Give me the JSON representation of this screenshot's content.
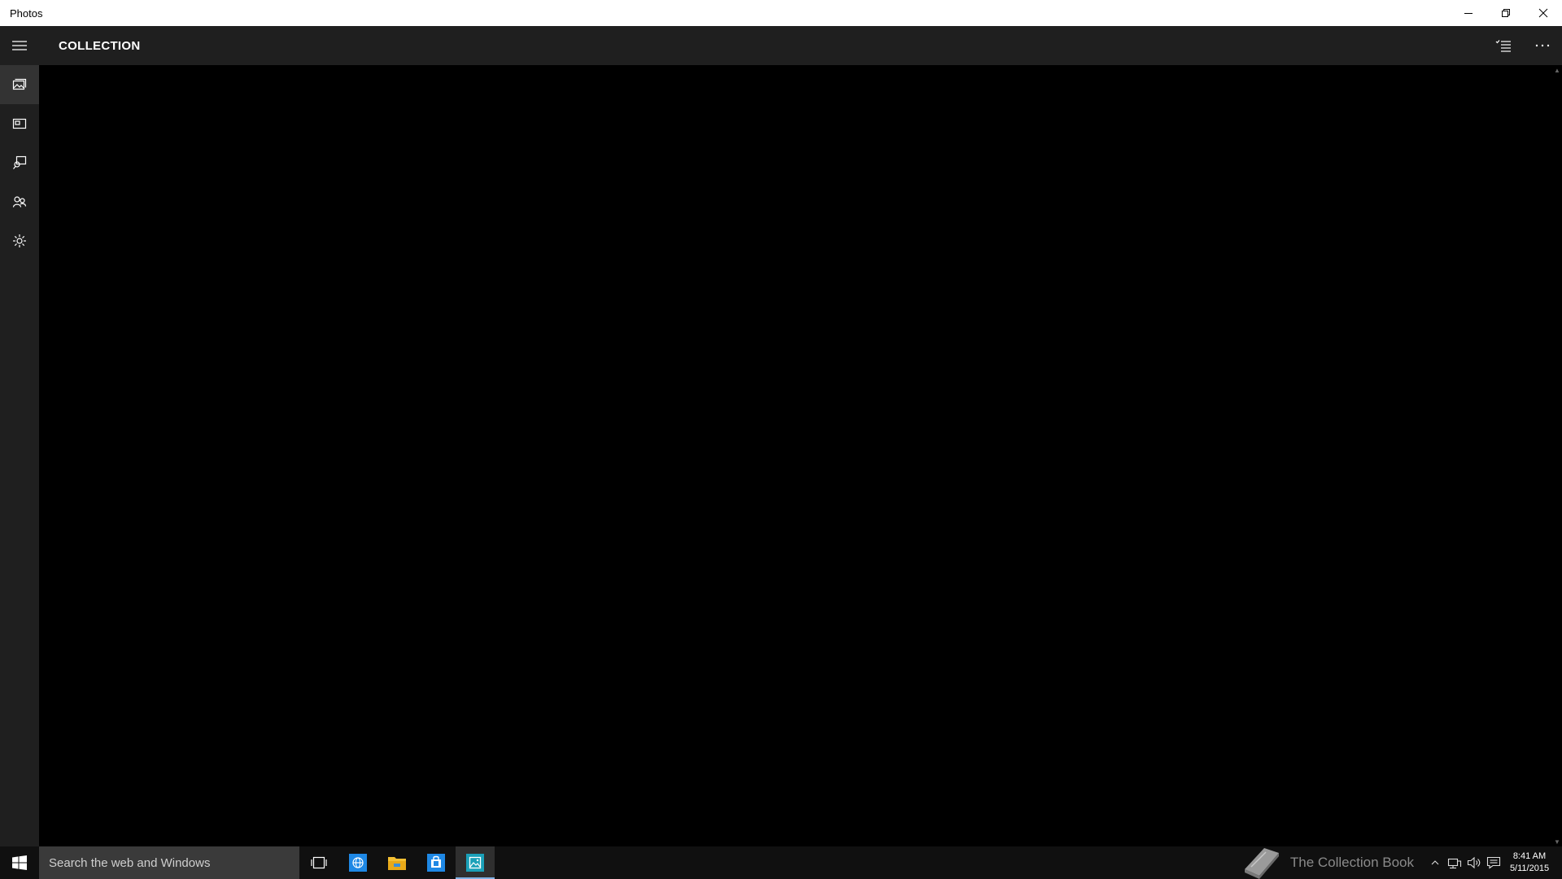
{
  "window": {
    "title": "Photos"
  },
  "header": {
    "title": "COLLECTION"
  },
  "rail": {
    "items": [
      {
        "name": "collection",
        "icon": "photos-icon",
        "active": true
      },
      {
        "name": "albums",
        "icon": "album-icon",
        "active": false
      },
      {
        "name": "folders",
        "icon": "folder-photos-icon",
        "active": false
      },
      {
        "name": "people",
        "icon": "people-icon",
        "active": false
      },
      {
        "name": "settings",
        "icon": "gear-icon",
        "active": false
      }
    ]
  },
  "taskbar": {
    "search_placeholder": "Search the web and Windows",
    "apps": [
      "task-view",
      "edge-browser",
      "file-explorer",
      "store",
      "photos"
    ],
    "watermark": "The Collection Book",
    "time": "8:41 AM",
    "date": "5/11/2015"
  },
  "colors": {
    "titlebar_bg": "#ffffff",
    "chrome_bg": "#1f1f1f",
    "content_bg": "#000000",
    "taskbar_bg": "#101010",
    "accent": "#1e88e5"
  }
}
